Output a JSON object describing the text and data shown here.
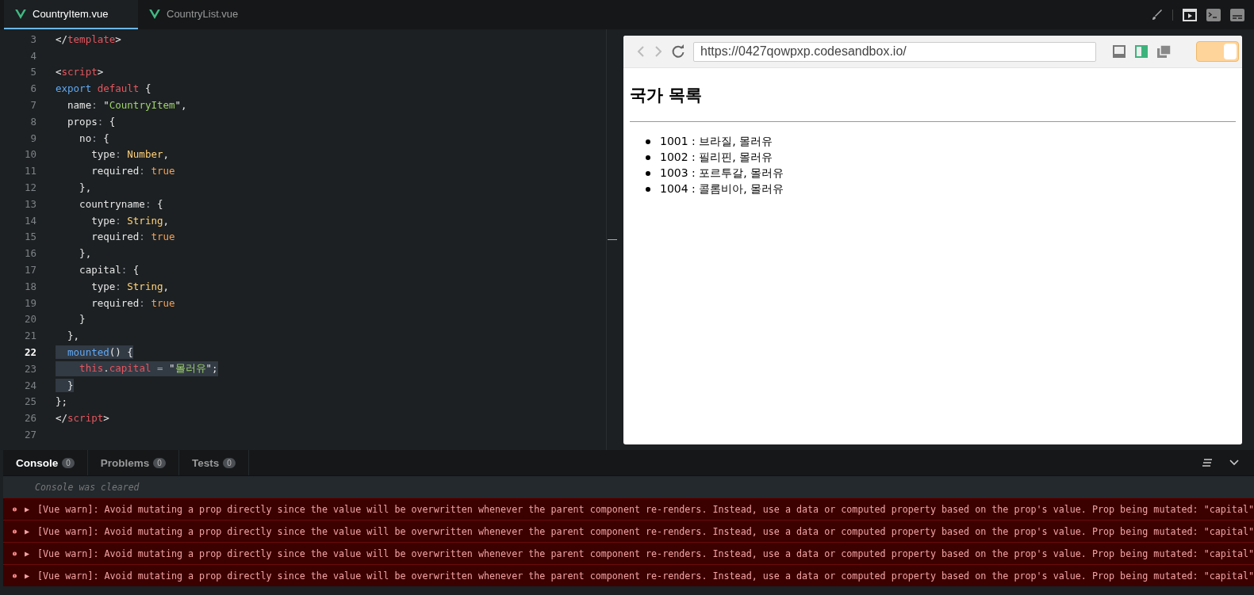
{
  "tabs": [
    {
      "label": "CountryItem.vue",
      "selected": true
    },
    {
      "label": "CountryList.vue",
      "selected": false
    }
  ],
  "editor": {
    "lines": [
      {
        "no": "3",
        "current": false,
        "highlighted": false,
        "tokens": [
          {
            "t": "</",
            "kind": "plain"
          },
          {
            "t": "template",
            "kind": "tag"
          },
          {
            "t": ">",
            "kind": "plain"
          }
        ]
      },
      {
        "no": "4",
        "current": false,
        "highlighted": false
      },
      {
        "no": "5",
        "current": false,
        "highlighted": false,
        "tokens": [
          {
            "t": "<",
            "kind": "plain"
          },
          {
            "t": "script",
            "kind": "tag"
          },
          {
            "t": ">",
            "kind": "plain"
          }
        ]
      },
      {
        "no": "6",
        "current": false,
        "highlighted": false,
        "tokens": [
          {
            "t": "export",
            "kind": "keyword"
          },
          {
            "t": " default",
            "kind": "tag"
          },
          {
            "t": " {",
            "kind": "plain"
          }
        ]
      },
      {
        "no": "7",
        "current": false,
        "highlighted": false,
        "tokens": [
          {
            "t": "  name",
            "kind": "plain"
          },
          {
            "t": ":",
            "kind": "operator"
          },
          {
            "t": " \"",
            "kind": "plain"
          },
          {
            "t": "CountryItem",
            "kind": "string"
          },
          {
            "t": "\",",
            "kind": "plain"
          }
        ]
      },
      {
        "no": "8",
        "current": false,
        "highlighted": false,
        "tokens": [
          {
            "t": "  props",
            "kind": "plain"
          },
          {
            "t": ":",
            "kind": "operator"
          },
          {
            "t": " {",
            "kind": "plain"
          }
        ]
      },
      {
        "no": "9",
        "current": false,
        "highlighted": false,
        "tokens": [
          {
            "t": "    no",
            "kind": "plain"
          },
          {
            "t": ":",
            "kind": "operator"
          },
          {
            "t": " {",
            "kind": "plain"
          }
        ]
      },
      {
        "no": "10",
        "current": false,
        "highlighted": false,
        "tokens": [
          {
            "t": "      type",
            "kind": "plain"
          },
          {
            "t": ":",
            "kind": "operator"
          },
          {
            "t": " Number",
            "kind": "type"
          },
          {
            "t": ",",
            "kind": "plain"
          }
        ]
      },
      {
        "no": "11",
        "current": false,
        "highlighted": false,
        "tokens": [
          {
            "t": "      required",
            "kind": "plain"
          },
          {
            "t": ":",
            "kind": "operator"
          },
          {
            "t": " true",
            "kind": "literal"
          }
        ]
      },
      {
        "no": "12",
        "current": false,
        "highlighted": false,
        "tokens": [
          {
            "t": "    },",
            "kind": "plain"
          }
        ]
      },
      {
        "no": "13",
        "current": false,
        "highlighted": false,
        "tokens": [
          {
            "t": "    countryname",
            "kind": "plain"
          },
          {
            "t": ":",
            "kind": "operator"
          },
          {
            "t": " {",
            "kind": "plain"
          }
        ]
      },
      {
        "no": "14",
        "current": false,
        "highlighted": false,
        "tokens": [
          {
            "t": "      type",
            "kind": "plain"
          },
          {
            "t": ":",
            "kind": "operator"
          },
          {
            "t": " String",
            "kind": "type"
          },
          {
            "t": ",",
            "kind": "plain"
          }
        ]
      },
      {
        "no": "15",
        "current": false,
        "highlighted": false,
        "tokens": [
          {
            "t": "      required",
            "kind": "plain"
          },
          {
            "t": ":",
            "kind": "operator"
          },
          {
            "t": " true",
            "kind": "literal"
          }
        ]
      },
      {
        "no": "16",
        "current": false,
        "highlighted": false,
        "tokens": [
          {
            "t": "    },",
            "kind": "plain"
          }
        ]
      },
      {
        "no": "17",
        "current": false,
        "highlighted": false,
        "tokens": [
          {
            "t": "    capital",
            "kind": "plain"
          },
          {
            "t": ":",
            "kind": "operator"
          },
          {
            "t": " {",
            "kind": "plain"
          }
        ]
      },
      {
        "no": "18",
        "current": false,
        "highlighted": false,
        "tokens": [
          {
            "t": "      type",
            "kind": "plain"
          },
          {
            "t": ":",
            "kind": "operator"
          },
          {
            "t": " String",
            "kind": "type"
          },
          {
            "t": ",",
            "kind": "plain"
          }
        ]
      },
      {
        "no": "19",
        "current": false,
        "highlighted": false,
        "tokens": [
          {
            "t": "      required",
            "kind": "plain"
          },
          {
            "t": ":",
            "kind": "operator"
          },
          {
            "t": " true",
            "kind": "literal"
          }
        ]
      },
      {
        "no": "20",
        "current": false,
        "highlighted": false,
        "tokens": [
          {
            "t": "    }",
            "kind": "plain"
          }
        ]
      },
      {
        "no": "21",
        "current": false,
        "highlighted": false,
        "tokens": [
          {
            "t": "  },",
            "kind": "plain"
          }
        ]
      },
      {
        "no": "22",
        "current": true,
        "highlighted": true,
        "tokens": [
          {
            "t": "  mounted",
            "kind": "keyword"
          },
          {
            "t": "() {",
            "kind": "plain"
          }
        ]
      },
      {
        "no": "23",
        "current": false,
        "highlighted": true,
        "tokens": [
          {
            "t": "    this",
            "kind": "tag"
          },
          {
            "t": ".",
            "kind": "plain"
          },
          {
            "t": "capital",
            "kind": "tag"
          },
          {
            "t": " = ",
            "kind": "operator"
          },
          {
            "t": "\"",
            "kind": "plain"
          },
          {
            "t": "몰러유",
            "kind": "string"
          },
          {
            "t": "\";",
            "kind": "plain"
          }
        ]
      },
      {
        "no": "24",
        "current": false,
        "highlighted": true,
        "tokens": [
          {
            "t": "  }",
            "kind": "plain"
          }
        ]
      },
      {
        "no": "25",
        "current": false,
        "highlighted": false,
        "tokens": [
          {
            "t": "};",
            "kind": "plain"
          }
        ]
      },
      {
        "no": "26",
        "current": false,
        "highlighted": false,
        "tokens": [
          {
            "t": "</",
            "kind": "plain"
          },
          {
            "t": "script",
            "kind": "tag"
          },
          {
            "t": ">",
            "kind": "plain"
          }
        ]
      },
      {
        "no": "27",
        "current": false,
        "highlighted": false
      }
    ]
  },
  "browser": {
    "url": "https://0427qowpxp.codesandbox.io/",
    "toggle": {
      "on": true
    },
    "heading": "국가 목록",
    "items": [
      "1001 : 브라질, 몰러유",
      "1002 : 필리핀, 몰러유",
      "1003 : 포르투갈, 몰러유",
      "1004 : 콜롬비아, 몰러유"
    ]
  },
  "panel": {
    "tabs": [
      {
        "label": "Console",
        "count": "0",
        "selected": true
      },
      {
        "label": "Problems",
        "count": "0",
        "selected": false
      },
      {
        "label": "Tests",
        "count": "0",
        "selected": false
      }
    ],
    "cleared": "Console was cleared",
    "messages": [
      {
        "arrow": "▶",
        "text": "[Vue warn]: Avoid mutating a prop directly since the value will be overwritten whenever the parent component re-renders. Instead, use a data or computed property based on the prop's value. Prop being mutated: \"capital\""
      },
      {
        "arrow": "▶",
        "text": "[Vue warn]: Avoid mutating a prop directly since the value will be overwritten whenever the parent component re-renders. Instead, use a data or computed property based on the prop's value. Prop being mutated: \"capital\""
      },
      {
        "arrow": "▶",
        "text": "[Vue warn]: Avoid mutating a prop directly since the value will be overwritten whenever the parent component re-renders. Instead, use a data or computed property based on the prop's value. Prop being mutated: \"capital\""
      },
      {
        "arrow": "▶",
        "text": "[Vue warn]: Avoid mutating a prop directly since the value will be overwritten whenever the parent component re-renders. Instead, use a data or computed property based on the prop's value. Prop being mutated: \"capital\""
      }
    ]
  }
}
